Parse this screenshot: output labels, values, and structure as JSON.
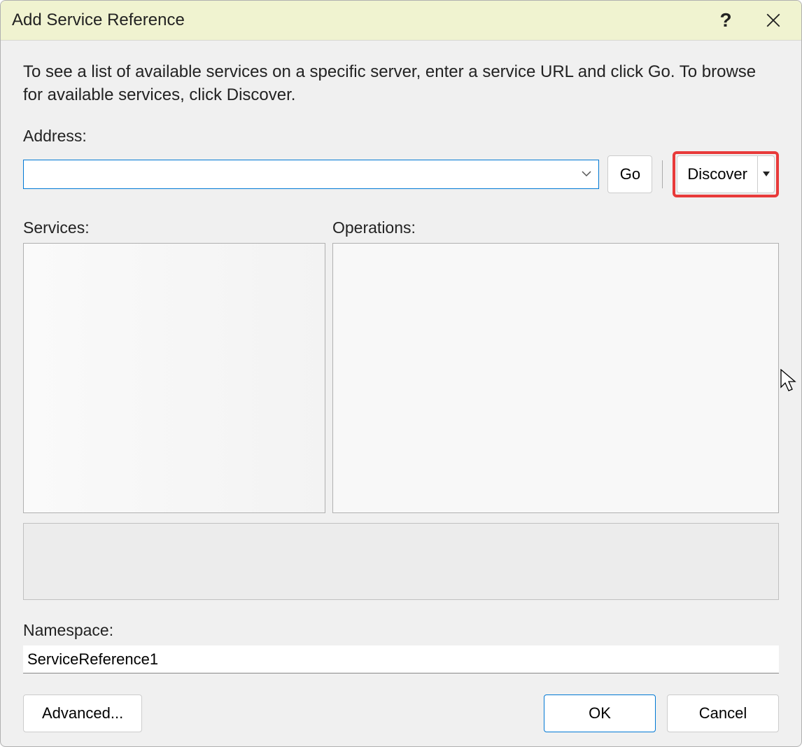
{
  "dialog": {
    "title": "Add Service Reference",
    "instruction": "To see a list of available services on a specific server, enter a service URL and click Go. To browse for available services, click Discover."
  },
  "address": {
    "label": "Address:",
    "value": "",
    "go_label": "Go",
    "discover_label": "Discover"
  },
  "services": {
    "label": "Services:"
  },
  "operations": {
    "label": "Operations:"
  },
  "namespace": {
    "label": "Namespace:",
    "value": "ServiceReference1"
  },
  "footer": {
    "advanced_label": "Advanced...",
    "ok_label": "OK",
    "cancel_label": "Cancel"
  },
  "highlight": {
    "target": "discover-button",
    "color": "#e83a3a"
  }
}
